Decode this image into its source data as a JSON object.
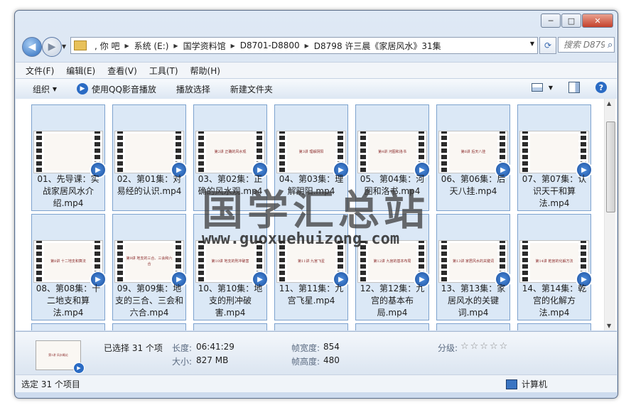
{
  "window": {
    "controls": {
      "minimize": "─",
      "maximize": "□",
      "close": "✕"
    }
  },
  "nav": {
    "breadcrumbs": [
      ", 你  吧",
      "系统 (E:)",
      "国学资料馆",
      "D8701-D8800",
      "D8798 许三晨《家居风水》31集"
    ],
    "search_placeholder": "搜索 D879..."
  },
  "menu": [
    "文件(F)",
    "编辑(E)",
    "查看(V)",
    "工具(T)",
    "帮助(H)"
  ],
  "toolbar": {
    "organize": "组织",
    "play_qq": "使用QQ影音播放",
    "play_selection": "播放选择",
    "new_folder": "新建文件夹"
  },
  "files": [
    {
      "name": "01、先导课：实战家居风水介绍.mp4",
      "thumb": ""
    },
    {
      "name": "02、第01集：对易经的认识.mp4",
      "thumb": ""
    },
    {
      "name": "03、第02集：正确的风水观.mp4",
      "thumb": "第2讲 正确的风水观"
    },
    {
      "name": "04、第03集：理解阴阳.mp4",
      "thumb": "第3讲 理解阴阳"
    },
    {
      "name": "05、第04集：河图和洛书.mp4",
      "thumb": "第4讲 河图和洛书"
    },
    {
      "name": "06、第06集：后天八挂.mp4",
      "thumb": "第6讲 后天八挂"
    },
    {
      "name": "07、第07集：认识天干和算法.mp4",
      "thumb": ""
    },
    {
      "name": "08、第08集：十二地支和算法.mp4",
      "thumb": "第8讲 十二地支和算法"
    },
    {
      "name": "09、第09集：地支的三合、三会和六合.mp4",
      "thumb": "第9讲 地支的三合、三会和六合"
    },
    {
      "name": "10、第10集：地支的刑冲破害.mp4",
      "thumb": "第10讲 地支的刑冲破害"
    },
    {
      "name": "11、第11集：九宫飞星.mp4",
      "thumb": "第11讲 九宫飞星"
    },
    {
      "name": "12、第12集：九宫的基本布局.mp4",
      "thumb": "第12讲 九宫的基本布局"
    },
    {
      "name": "13、第13集：家居风水的关键词.mp4",
      "thumb": "第13讲 家居风水的关键词"
    },
    {
      "name": "14、第14集：乾宫的化解方法.mp4",
      "thumb": "第14讲 乾宫的化解方法"
    }
  ],
  "watermark": {
    "cn": "国学汇总站",
    "en": "www.guoxuehuizong.com"
  },
  "details": {
    "selected": "已选择 31 个项",
    "length_label": "长度:",
    "length": "06:41:29",
    "size_label": "大小:",
    "size": "827 MB",
    "frame_width_label": "帧宽度:",
    "frame_width": "854",
    "frame_height_label": "帧高度:",
    "frame_height": "480",
    "rating_label": "分级:",
    "rating_stars": "☆☆☆☆☆",
    "thumb_text": "第1讲 风水概论"
  },
  "status": {
    "left": "选定 31 个项目",
    "right": "计算机"
  }
}
